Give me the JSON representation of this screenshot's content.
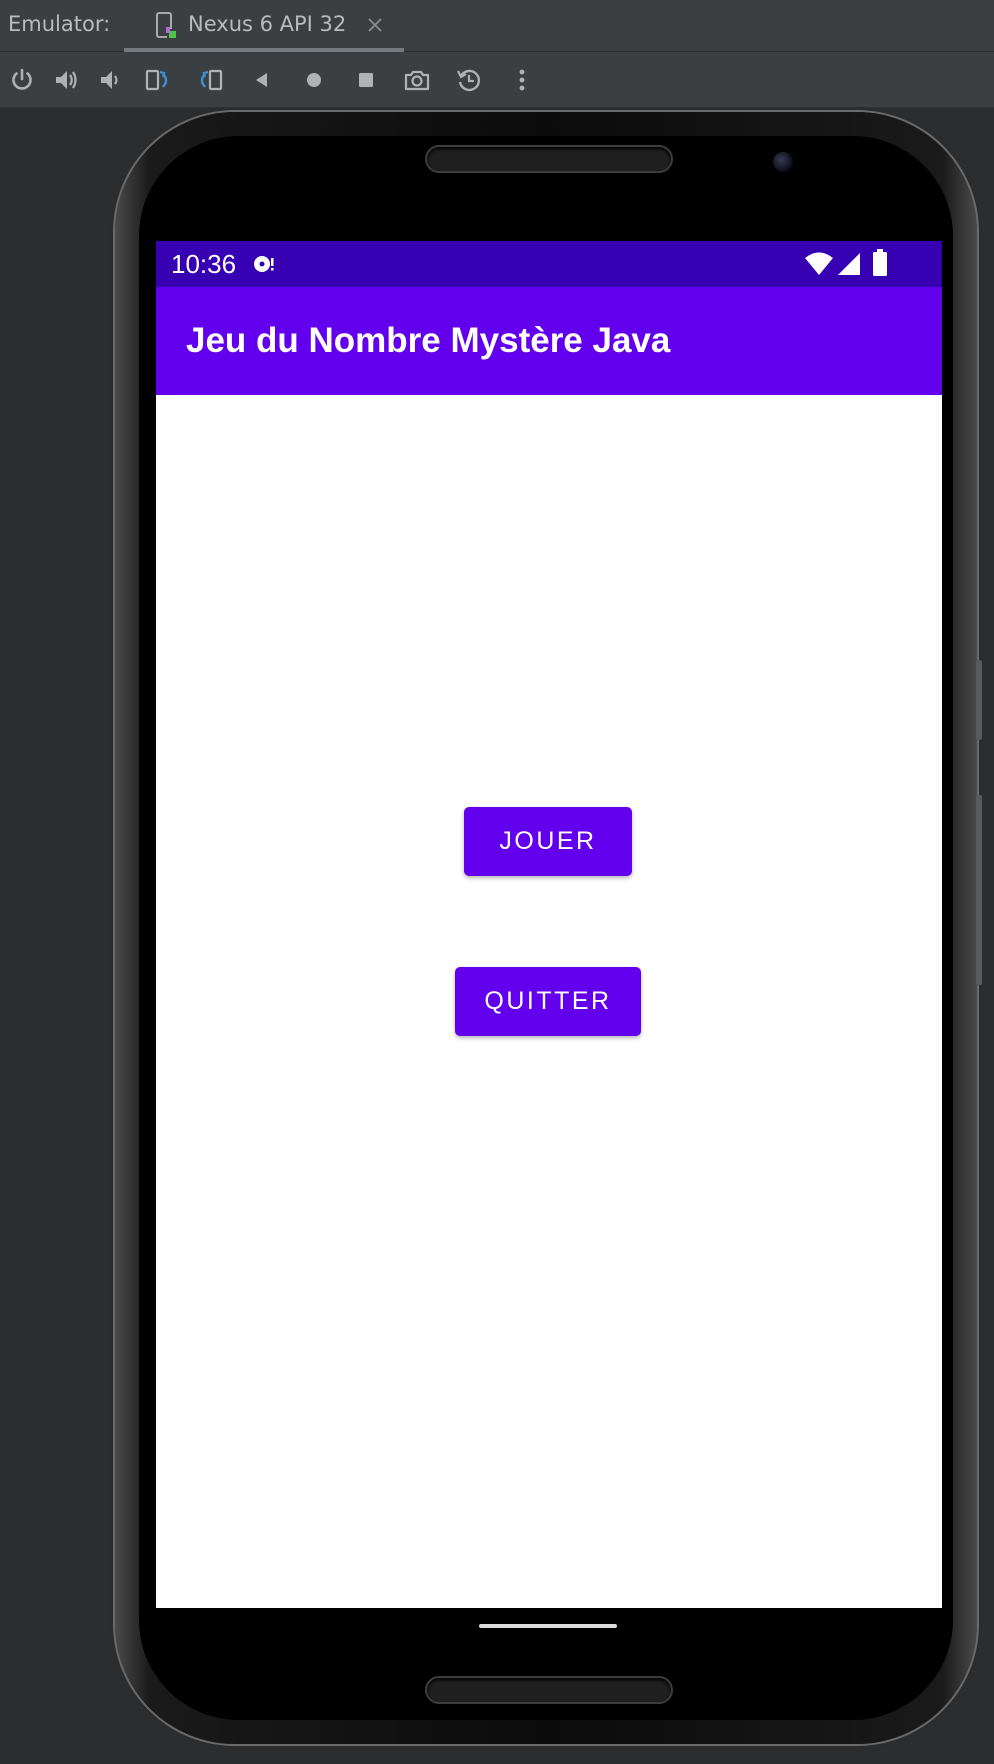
{
  "emulator": {
    "label": "Emulator:",
    "tab": {
      "label": "Nexus 6 API 32"
    }
  },
  "toolbar": {
    "buttons": [
      {
        "icon": "power-icon"
      },
      {
        "icon": "volume-up-icon"
      },
      {
        "icon": "volume-down-icon"
      },
      {
        "icon": "rotate-left-icon"
      },
      {
        "icon": "rotate-right-icon"
      },
      {
        "icon": "back-icon"
      },
      {
        "icon": "home-icon"
      },
      {
        "icon": "overview-icon"
      },
      {
        "icon": "screenshot-icon"
      },
      {
        "icon": "snapshot-restore-icon"
      },
      {
        "icon": "more-icon"
      }
    ]
  },
  "device": {
    "status_bar": {
      "time": "10:36",
      "icons": [
        "notification-icon",
        "wifi-icon",
        "signal-icon",
        "battery-icon"
      ]
    },
    "app_bar": {
      "title": "Jeu du Nombre Mystère Java"
    },
    "buttons": {
      "play": "JOUER",
      "quit": "QUITTER"
    }
  },
  "colors": {
    "status_bar": "#3700b3",
    "primary": "#6200ee",
    "ide_background": "#3c3f41",
    "emulator_background": "#2b2d2f",
    "on_primary": "#ffffff"
  }
}
